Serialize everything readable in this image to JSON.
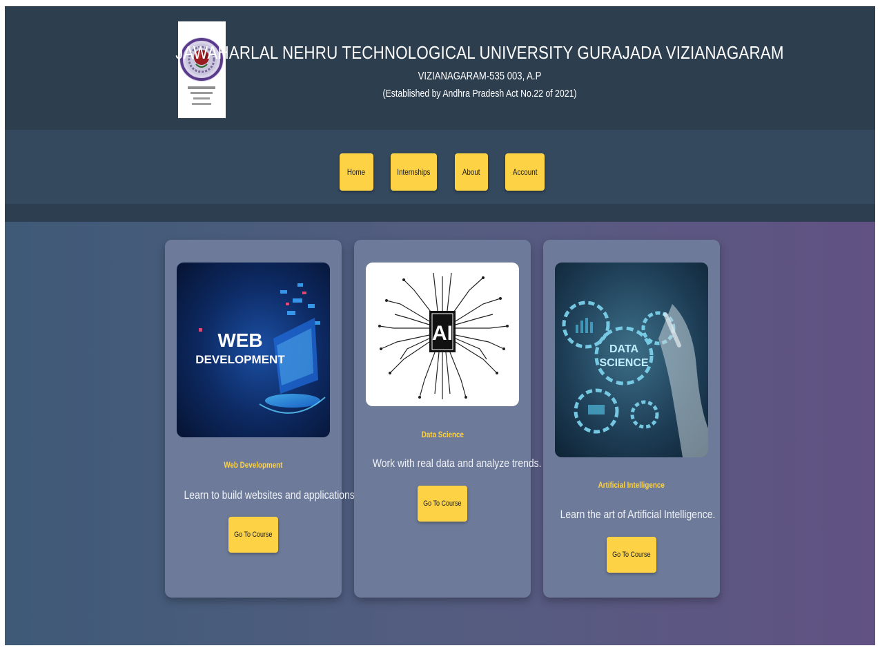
{
  "header": {
    "title": "JAWAHARLAL NEHRU TECHNOLOGICAL UNIVERSITY GURAJADA VIZIANAGARAM",
    "address": "VIZIANAGARAM-535 003, A.P",
    "established": "(Established by Andhra Pradesh Act No.22 of 2021)",
    "logo_icon": "university-seal-logo"
  },
  "nav": {
    "items": [
      {
        "label": "Home"
      },
      {
        "label": "Internships"
      },
      {
        "label": "About"
      },
      {
        "label": "Account"
      }
    ]
  },
  "courses": [
    {
      "image_text_1": "WEB",
      "image_text_2": "DEVELOPMENT",
      "title": "Web Development",
      "description": "Learn to build websites and applications.",
      "button_label": "Go To Course"
    },
    {
      "image_text_1": "AI",
      "title": "Data Science",
      "description": "Work with real data and analyze trends.",
      "button_label": "Go To Course"
    },
    {
      "image_text_1": "DATA",
      "image_text_2": "SCIENCE",
      "title": "Artificial Intelligence",
      "description": "Learn the art of Artificial Intelligence.",
      "button_label": "Go To Course"
    }
  ],
  "colors": {
    "header_bg": "#2d3e4f",
    "nav_bg": "#34495e",
    "accent_yellow": "#fdd345",
    "card_bg": "#6d7a99"
  }
}
